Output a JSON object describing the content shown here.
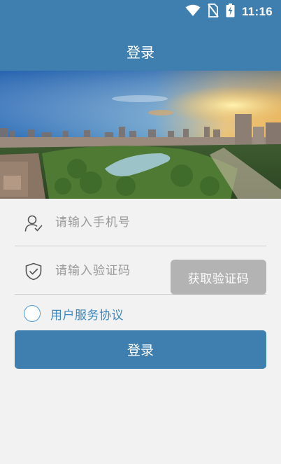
{
  "status_bar": {
    "time": "11:16",
    "icons": [
      "wifi-icon",
      "no-sim-icon",
      "battery-charging-icon"
    ]
  },
  "header": {
    "title": "登录"
  },
  "banner": {
    "description": "city skyline with park, lake and sunset"
  },
  "form": {
    "phone": {
      "icon": "user-icon",
      "placeholder": "请输入手机号",
      "value": ""
    },
    "code": {
      "icon": "shield-check-icon",
      "placeholder": "请输入验证码",
      "value": ""
    },
    "get_code_label": "获取验证码",
    "agreement": {
      "label": "用户服务协议",
      "checked": false
    },
    "login_label": "登录"
  },
  "colors": {
    "primary": "#3e7fb0",
    "disabled_button": "#b3b3b3",
    "link": "#3b88bf",
    "background": "#f2f2f2"
  }
}
